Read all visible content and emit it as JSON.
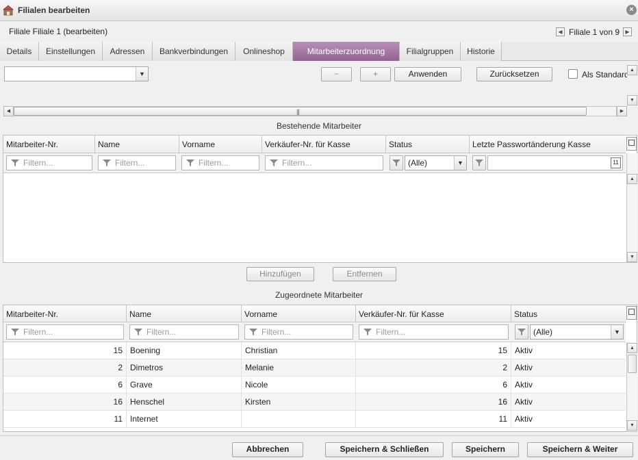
{
  "window": {
    "title": "Filialen bearbeiten",
    "subtitle": "Filiale Filiale 1 (bearbeiten)",
    "pager_text": "Filiale 1 von 9"
  },
  "tabs": [
    {
      "label": "Details"
    },
    {
      "label": "Einstellungen"
    },
    {
      "label": "Adressen"
    },
    {
      "label": "Bankverbindungen"
    },
    {
      "label": "Onlineshop"
    },
    {
      "label": "Mitarbeiterzuordnung",
      "active": true
    },
    {
      "label": "Filialgruppen"
    },
    {
      "label": "Historie"
    }
  ],
  "toolbar": {
    "layout_select_value": "",
    "minus_label": "−",
    "plus_label": "+",
    "apply_label": "Anwenden",
    "reset_label": "Zurücksetzen",
    "default_label": "Als Standard"
  },
  "existing": {
    "section_label": "Bestehende Mitarbeiter",
    "columns": [
      "Mitarbeiter-Nr.",
      "Name",
      "Vorname",
      "Verkäufer-Nr. für Kasse",
      "Status",
      "Letzte Passwortänderung Kasse"
    ],
    "filter_placeholder": "Filtern...",
    "status_filter_value": "(Alle)",
    "rows": []
  },
  "middle_buttons": {
    "add_label": "Hinzufügen",
    "remove_label": "Entfernen"
  },
  "assigned": {
    "section_label": "Zugeordnete Mitarbeiter",
    "columns": [
      "Mitarbeiter-Nr.",
      "Name",
      "Vorname",
      "Verkäufer-Nr. für Kasse",
      "Status"
    ],
    "filter_placeholder": "Filtern...",
    "status_filter_value": "(Alle)",
    "rows": [
      {
        "nr": "15",
        "name": "Boening",
        "vorname": "Christian",
        "kasse": "15",
        "status": "Aktiv"
      },
      {
        "nr": "2",
        "name": "Dimetros",
        "vorname": "Melanie",
        "kasse": "2",
        "status": "Aktiv"
      },
      {
        "nr": "6",
        "name": "Grave",
        "vorname": "Nicole",
        "kasse": "6",
        "status": "Aktiv"
      },
      {
        "nr": "16",
        "name": "Henschel",
        "vorname": "Kirsten",
        "kasse": "16",
        "status": "Aktiv"
      },
      {
        "nr": "11",
        "name": "Internet",
        "vorname": "",
        "kasse": "11",
        "status": "Aktiv"
      }
    ]
  },
  "footer": {
    "cancel_label": "Abbrechen",
    "save_close_label": "Speichern & Schließen",
    "save_label": "Speichern",
    "save_next_label": "Speichern & Weiter"
  }
}
